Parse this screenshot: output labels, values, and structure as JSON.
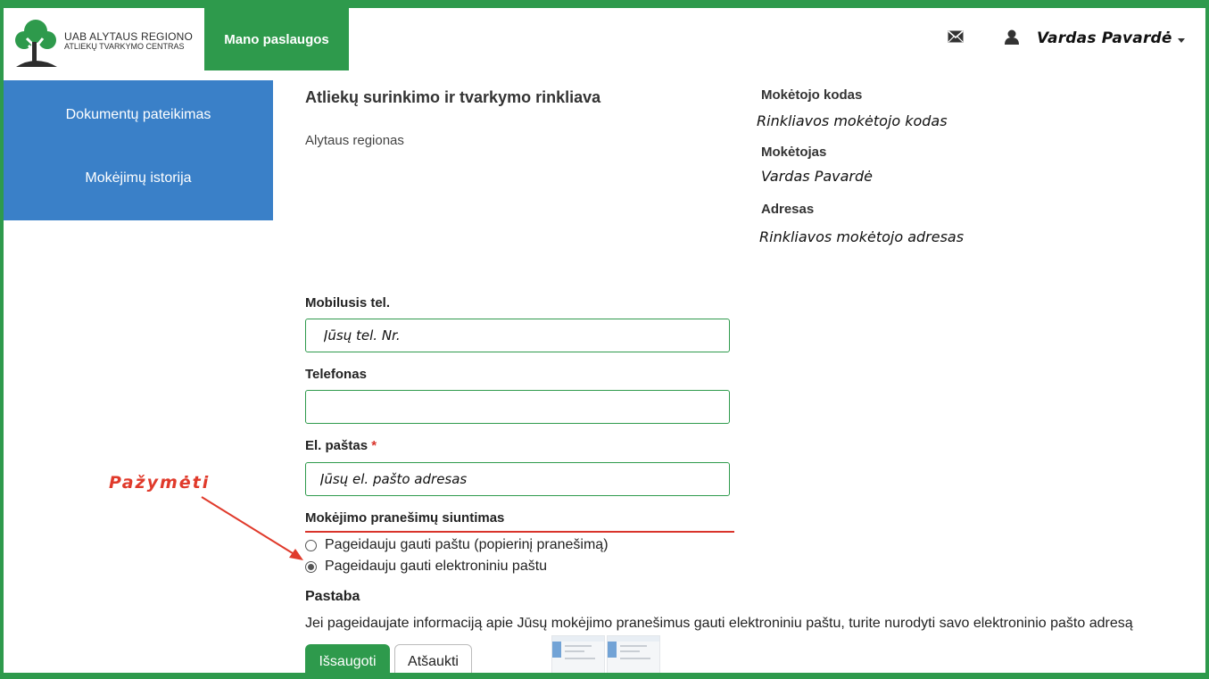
{
  "brand": {
    "line1": "UAB ALYTAUS REGIONO",
    "line2": "ATLIEKŲ TVARKYMO CENTRAS"
  },
  "nav": {
    "active_tab": "Mano paslaugos"
  },
  "user": {
    "name": "Vardas Pavardė"
  },
  "sidebar": {
    "items": [
      {
        "label": "Dokumentų pateikimas"
      },
      {
        "label": "Mokėjimų istorija"
      }
    ]
  },
  "main": {
    "title": "Atliekų surinkimo ir tvarkymo rinkliava",
    "region": "Alytaus regionas"
  },
  "payer": {
    "code_label": "Mokėtojo kodas",
    "code_value": "Rinkliavos mokėtojo kodas",
    "payer_label": "Mokėtojas",
    "payer_value": "Vardas Pavardė",
    "address_label": "Adresas",
    "address_value": "Rinkliavos mokėtojo adresas"
  },
  "form": {
    "mobile_label": "Mobilusis tel.",
    "mobile_value": "Jūsų tel. Nr.",
    "phone_label": "Telefonas",
    "phone_value": "",
    "email_label": "El. paštas",
    "email_required": "*",
    "email_value": "Jūsų el. pašto adresas",
    "delivery_heading": "Mokėjimo pranešimų siuntimas",
    "delivery_options": [
      {
        "label": "Pageidauju gauti paštu (popierinį pranešimą)",
        "checked": false
      },
      {
        "label": "Pageidauju gauti elektroniniu paštu",
        "checked": true
      }
    ],
    "note_heading": "Pastaba",
    "note_text": "Jei pageidaujate informaciją apie Jūsų mokėjimo pranešimus gauti elektroniniu paštu, turite nurodyti savo elektroninio pašto adresą",
    "save_label": "Išsaugoti",
    "cancel_label": "Atšaukti"
  },
  "annotation": {
    "text": "Pažymėti",
    "color": "#e03a2b"
  },
  "colors": {
    "brand_green": "#2e9a4c",
    "sidebar_blue": "#3a80c8"
  },
  "icons": [
    "tree-logo-icon",
    "mail-icon",
    "user-icon",
    "caret-down-icon",
    "radio-icon",
    "arrow-icon"
  ]
}
